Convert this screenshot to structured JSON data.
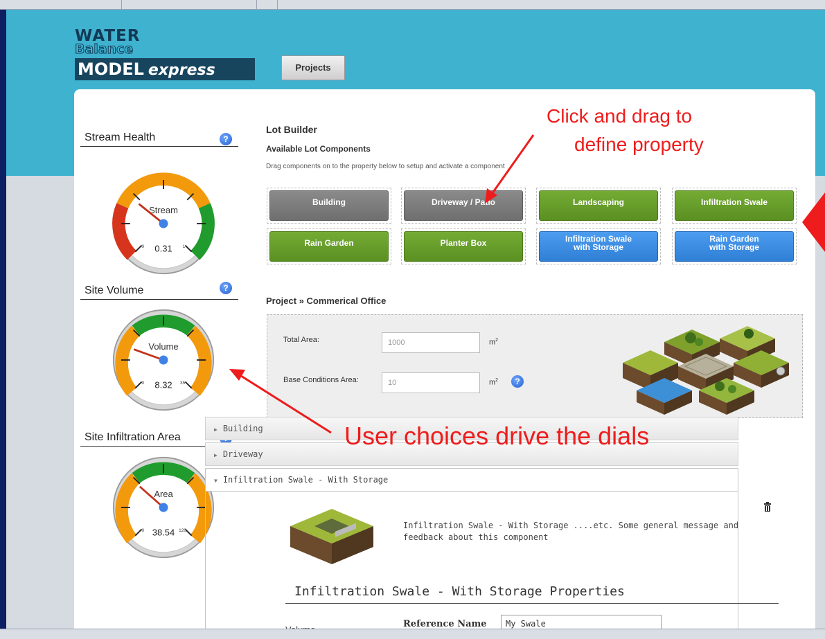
{
  "app": {
    "logo_line1": "WATER",
    "logo_line2": "Balance",
    "logo_line3": "MODEL",
    "logo_line3_suffix": "express",
    "projects_button": "Projects"
  },
  "metrics": [
    {
      "label": "Stream Health",
      "dial_label": "Stream",
      "min": "0",
      "max": "1",
      "value": "0.31",
      "fraction": 0.31
    },
    {
      "label": "Site Volume",
      "dial_label": "Volume",
      "min": "0",
      "max": "35",
      "value": "8.32",
      "fraction": 0.24
    },
    {
      "label": "Site Infiltration Area",
      "dial_label": "Area",
      "min": "0",
      "max": "120",
      "value": "38.54",
      "fraction": 0.32
    }
  ],
  "help_glyph": "?",
  "lot_builder": {
    "title": "Lot Builder",
    "subtitle": "Available Lot Components",
    "description": "Drag components on to the property below to setup and activate a component",
    "components": [
      {
        "label": "Building",
        "color": "gray"
      },
      {
        "label": "Driveway / Patio",
        "color": "gray"
      },
      {
        "label": "Landscaping",
        "color": "green"
      },
      {
        "label": "Infiltration Swale",
        "color": "green"
      },
      {
        "label": "Rain Garden",
        "color": "green"
      },
      {
        "label": "Planter Box",
        "color": "green"
      },
      {
        "label": "Infiltration Swale\nwith Storage",
        "color": "blue"
      },
      {
        "label": "Rain Garden\nwith Storage",
        "color": "blue"
      }
    ]
  },
  "project": {
    "title": "Project » Commerical Office",
    "total_area_label": "Total Area:",
    "total_area_value": "1000",
    "base_area_label": "Base Conditions Area:",
    "base_area_value": "10",
    "unit": "m",
    "unit_sup": "2"
  },
  "accordion": {
    "building": "Building",
    "driveway": "Driveway",
    "swale": "Infiltration Swale - With Storage",
    "swale_description": "Infiltration Swale - With Storage ....etc. Some general message and feedback about this component",
    "props_title": "Infiltration Swale - With Storage Properties",
    "volume_label": "Volume",
    "reference_name_label": "Reference Name",
    "reference_name_value": "My Swale"
  },
  "annotations": {
    "drag_line1": "Click  and drag  to",
    "drag_line2": "define  property",
    "dials": "User choices drive the dials"
  },
  "colors": {
    "annotation": "#ee1c1c",
    "band": "#3fb2cf",
    "gauge_orange": "#f29a0c",
    "gauge_green": "#1f9c2d",
    "gauge_red": "#d6341c"
  }
}
